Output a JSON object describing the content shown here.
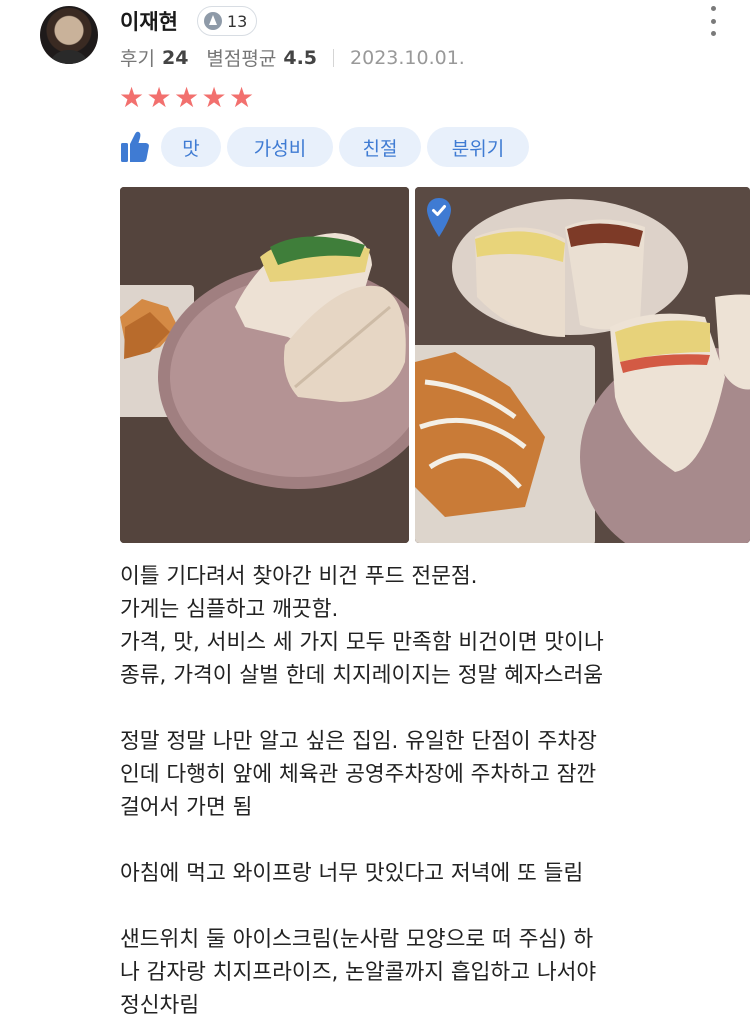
{
  "reviewer": {
    "name": "이재현",
    "level": "13",
    "review_label": "후기",
    "review_count": "24",
    "avg_label": "별점평균",
    "avg_rating": "4.5",
    "date": "2023.10.01.",
    "rating_stars": 5
  },
  "colors": {
    "star": "#f2706e",
    "chip_bg": "#e8f0fb",
    "chip_text": "#3f7bd3",
    "thumb_icon": "#3f7bd3"
  },
  "icons": {
    "more": "vertical-ellipsis-icon",
    "like": "thumbs-up-icon",
    "verified": "map-pin-check-icon",
    "level": "level-triangle-icon"
  },
  "tags": [
    "맛",
    "가성비",
    "친절",
    "분위기"
  ],
  "review_lines": [
    "이틀 기다려서 찾아간 비건 푸드  전문점.",
    "가게는 심플하고 깨끗함.",
    "가격, 맛, 서비스 세 가지 모두 만족함 비건이면 맛이나",
    "종류, 가격이 살벌 한데 치지레이지는 정말 혜자스러움",
    "",
    "정말 정말 나만 알고 싶은 집임. 유일한 단점이 주차장",
    "인데 다행히 앞에 체육관 공영주차장에 주차하고 잠깐",
    "걸어서 가면 됨",
    "",
    "아침에 먹고 와이프랑 너무 맛있다고 저녁에 또 들림",
    "",
    "샌드위치 둘  아이스크림(눈사람 모양으로 떠 주심) 하",
    "나 감자랑 치지프라이즈, 논알콜까지 흡입하고 나서야",
    "정신차림"
  ]
}
